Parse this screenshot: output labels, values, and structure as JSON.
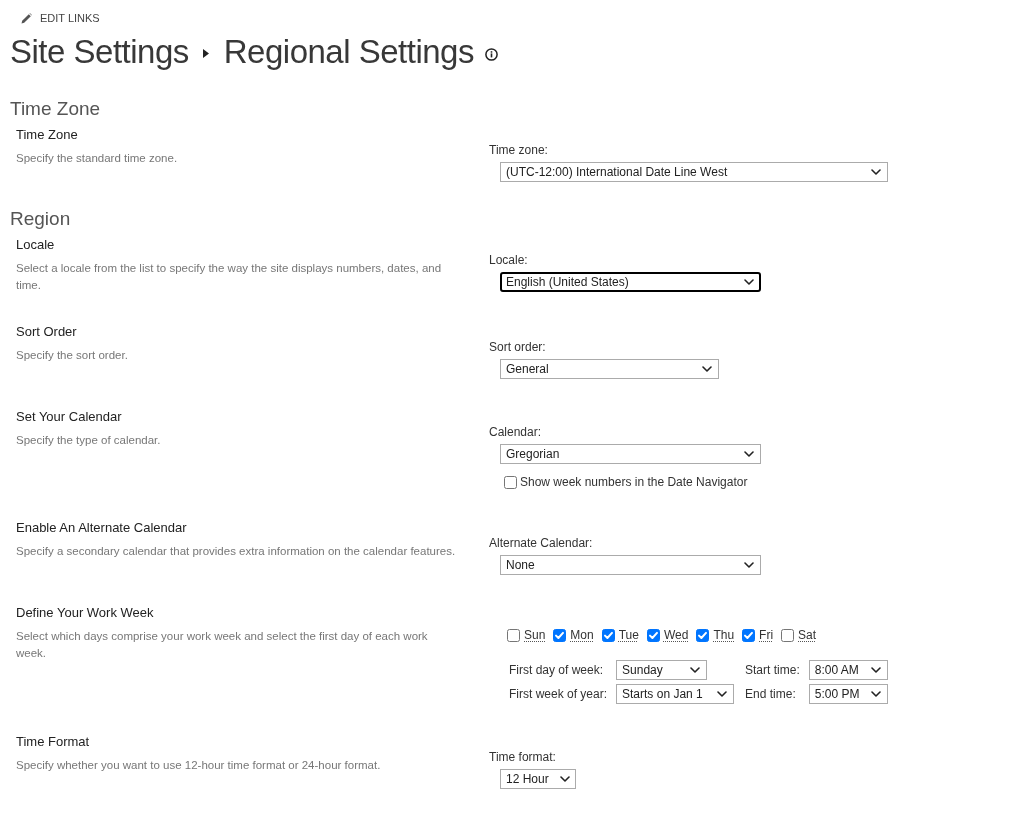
{
  "edit_links": {
    "label": "EDIT LINKS"
  },
  "breadcrumb": [
    {
      "label": "Site Settings"
    },
    {
      "label": "Regional Settings"
    }
  ],
  "groups": [
    {
      "title": "Time Zone",
      "sections": [
        {
          "title": "Time Zone",
          "description": "Specify the standard time zone.",
          "fields": [
            {
              "kind": "select",
              "label": "Time zone:",
              "value": "(UTC-12:00) International Date Line West",
              "focused": false
            }
          ]
        }
      ]
    },
    {
      "title": "Region",
      "sections": [
        {
          "title": "Locale",
          "description": "Select a locale from the list to specify the way the site displays numbers, dates, and time.",
          "fields": [
            {
              "kind": "select",
              "label": "Locale:",
              "value": "English (United States)",
              "focused": true
            }
          ]
        },
        {
          "title": "Sort Order",
          "description": "Specify the sort order.",
          "fields": [
            {
              "kind": "select",
              "label": "Sort order:",
              "value": "General",
              "focused": false
            }
          ]
        },
        {
          "title": "Set Your Calendar",
          "description": "Specify the type of calendar.",
          "fields": [
            {
              "kind": "select",
              "label": "Calendar:",
              "value": "Gregorian",
              "focused": false
            },
            {
              "kind": "checkbox",
              "label": "Show week numbers in the Date Navigator",
              "checked": false
            }
          ]
        },
        {
          "title": "Enable An Alternate Calendar",
          "description": "Specify a secondary calendar that provides extra information on the calendar features.",
          "fields": [
            {
              "kind": "select",
              "label": "Alternate Calendar:",
              "value": "None",
              "focused": false
            }
          ]
        },
        {
          "title": "Define Your Work Week",
          "description": "Select which days comprise your work week and select the first day of each work week.",
          "fields": [
            {
              "kind": "days",
              "days": [
                {
                  "label": "Sun",
                  "checked": false
                },
                {
                  "label": "Mon",
                  "checked": true
                },
                {
                  "label": "Tue",
                  "checked": true
                },
                {
                  "label": "Wed",
                  "checked": true
                },
                {
                  "label": "Thu",
                  "checked": true
                },
                {
                  "label": "Fri",
                  "checked": true
                },
                {
                  "label": "Sat",
                  "checked": false
                }
              ]
            },
            {
              "kind": "pairs",
              "rows": [
                [
                  {
                    "label": "First day of week:",
                    "value": "Sunday"
                  },
                  {
                    "label": "Start time:",
                    "value": "8:00 AM"
                  }
                ],
                [
                  {
                    "label": "First week of year:",
                    "value": "Starts on Jan 1"
                  },
                  {
                    "label": "End time:",
                    "value": "5:00 PM"
                  }
                ]
              ]
            }
          ]
        },
        {
          "title": "Time Format",
          "description": "Specify whether you want to use 12-hour time format or 24-hour format.",
          "fields": [
            {
              "kind": "select",
              "label": "Time format:",
              "value": "12 Hour",
              "focused": false
            }
          ]
        }
      ]
    }
  ]
}
